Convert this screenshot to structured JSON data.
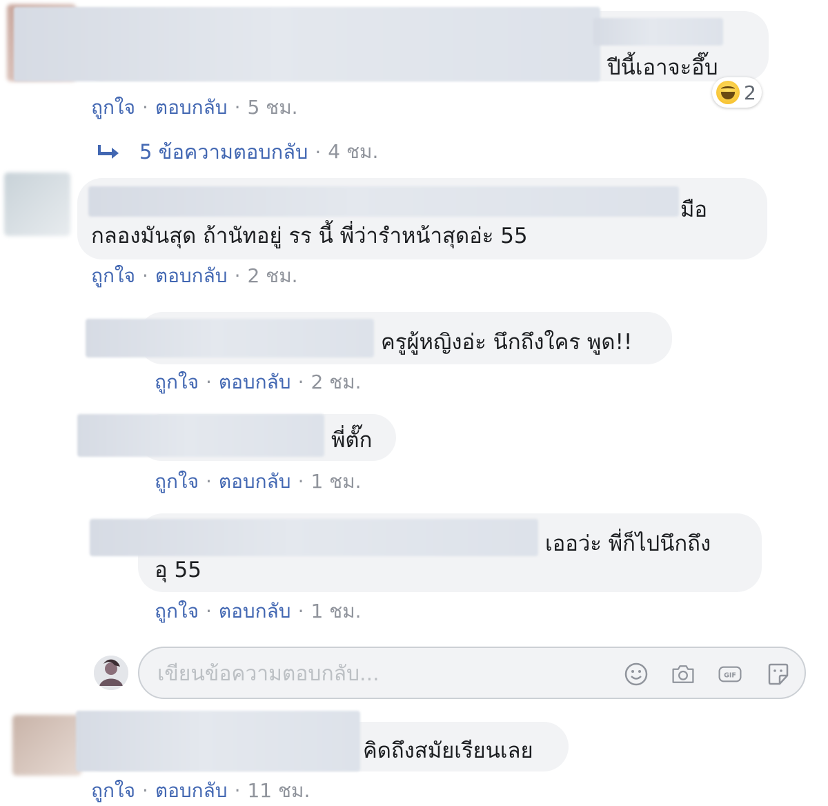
{
  "actions": {
    "like": "ถูกใจ",
    "reply": "ตอบกลับ"
  },
  "comments": [
    {
      "text_lines": [
        "ปีนี้เอาจะอึ๊บ"
      ],
      "time": "5 ชม.",
      "reaction": {
        "icon": "haha-reaction-icon",
        "count": "2"
      }
    },
    {
      "text_lines": [
        "มือ",
        "กลองมันสุด ถ้านัทอยู่ รร นี้ พี่ว่ารำหน้าสุดอ่ะ 55"
      ],
      "time": "2 ชม."
    },
    {
      "text_lines": [
        "ครูผู้หญิงอ่ะ นึกถึงใคร พูด!!"
      ],
      "time": "2 ชม."
    },
    {
      "text_lines": [
        "พี่ตั๊ก"
      ],
      "time": "1 ชม."
    },
    {
      "text_lines": [
        "เออว่ะ พี่ก็ไปนึกถึง",
        "อุ 55"
      ],
      "time": "1 ชม."
    },
    {
      "text_lines": [
        "คิดถึงสมัยเรียนเลย"
      ],
      "time": "11 ชม."
    }
  ],
  "replies_summary": {
    "label": "5 ข้อความตอบกลับ",
    "time": "4 ชม."
  },
  "reply_input": {
    "placeholder": "เขียนข้อความตอบกลับ..."
  },
  "colors": {
    "link": "#4267b2",
    "meta": "#90949c",
    "bubble": "#f2f3f5"
  }
}
